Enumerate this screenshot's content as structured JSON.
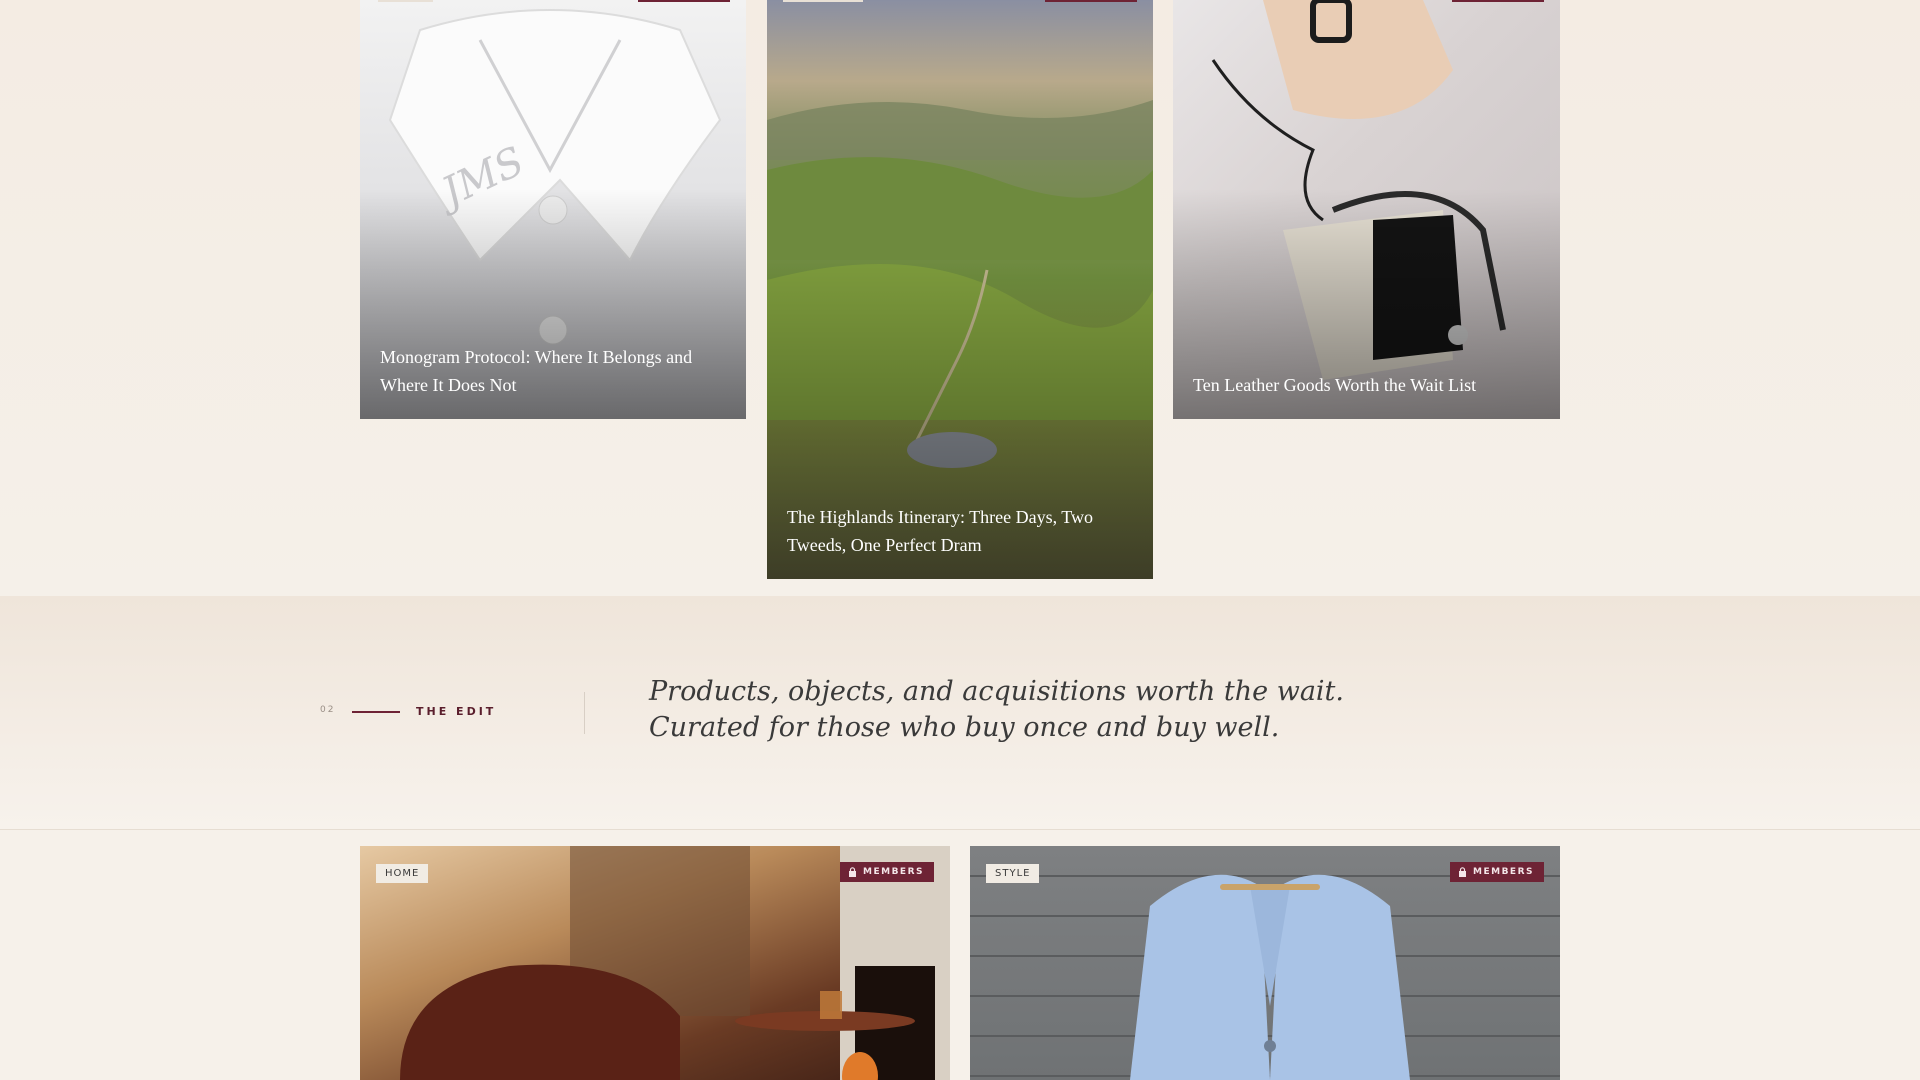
{
  "top_cards": [
    {
      "title": "Monogram Protocol: Where It Belongs and Where It Does Not"
    },
    {
      "title": "The Highlands Itinerary: Three Days, Two Tweeds, One Perfect Dram"
    },
    {
      "title": "Ten Leather Goods Worth the Wait List"
    }
  ],
  "section": {
    "number": "02",
    "label": "THE EDIT",
    "tagline_line1": "Products, objects, and acquisitions worth the wait.",
    "tagline_line2": "Curated for those who buy once and buy well."
  },
  "bottom_cards": [
    {
      "category": "HOME",
      "badge": "MEMBERS",
      "badge_icon": "lock-icon"
    },
    {
      "category": "STYLE",
      "badge": "MEMBERS",
      "badge_icon": "lock-icon"
    }
  ],
  "colors": {
    "accent": "#6e2335",
    "background": "#f6f1ea",
    "text_dark": "#3a3a3a"
  }
}
